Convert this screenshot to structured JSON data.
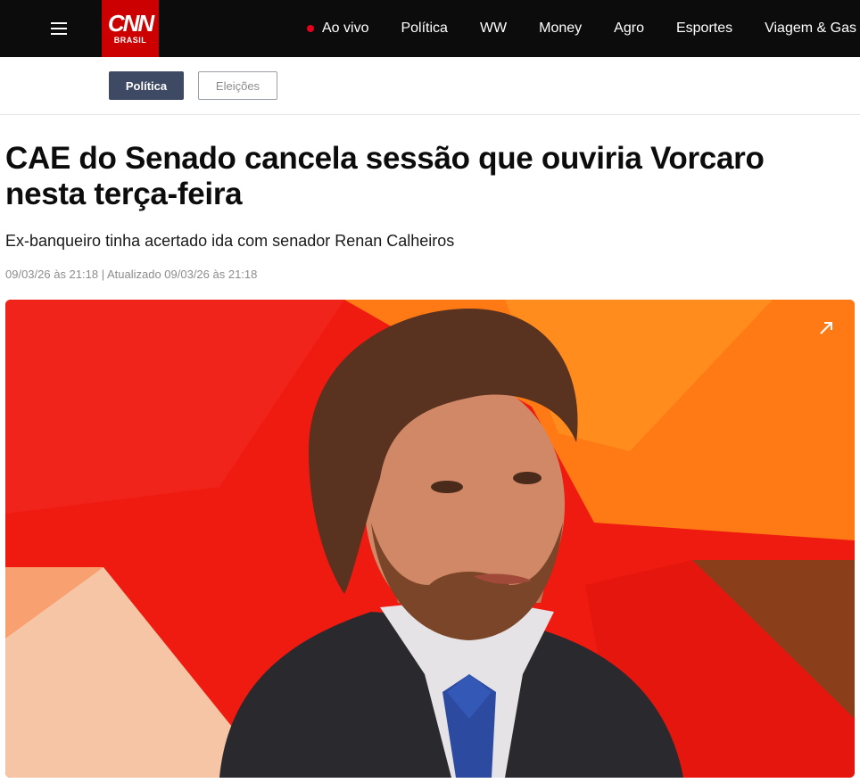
{
  "header": {
    "menu_icon": "hamburger-menu-icon",
    "logo": {
      "main": "CNN",
      "sub": "BRASIL",
      "bg_color": "#cc0000"
    },
    "live": {
      "label": "Ao vivo",
      "dot_color": "#e6001e"
    },
    "nav_items": [
      "Política",
      "WW",
      "Money",
      "Agro",
      "Esportes",
      "Viagem & Gas"
    ]
  },
  "tags": {
    "active": "Política",
    "inactive": "Eleições"
  },
  "article": {
    "headline": "CAE do Senado cancela sessão que ouviria Vorcaro nesta terça-feira",
    "subheadline": "Ex-banqueiro tinha acertado ida com senador Renan Calheiros",
    "meta": "09/03/26 às 21:18 | Atualizado 09/03/26 às 21:18"
  },
  "hero_image": {
    "description_icon": "expand-arrow-icon",
    "accent_color": "#ef1a10"
  }
}
